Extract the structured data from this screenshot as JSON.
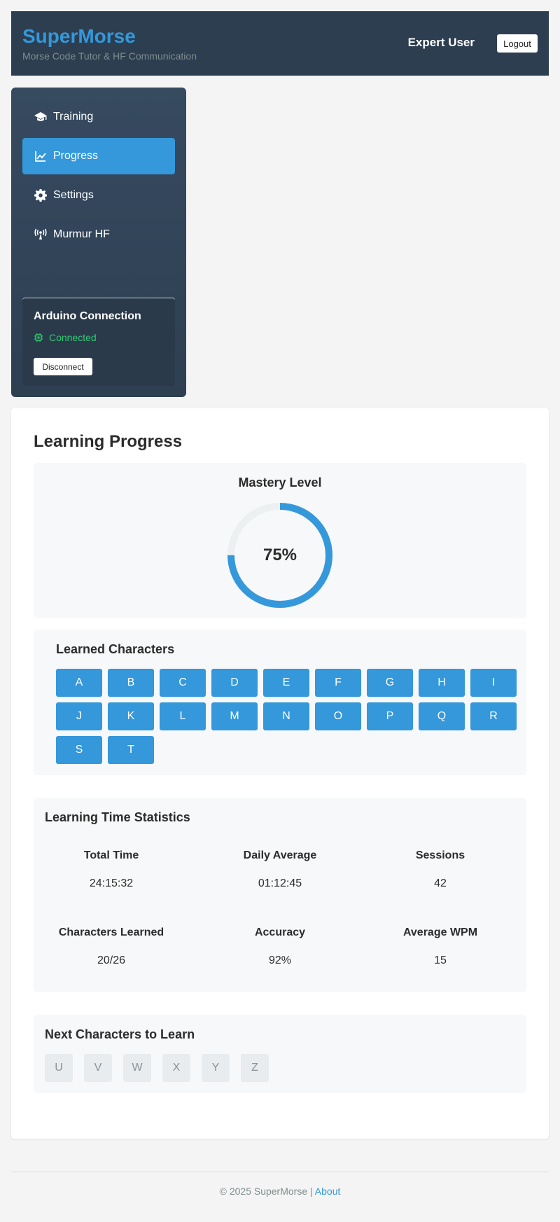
{
  "header": {
    "brand": "SuperMorse",
    "tagline": "Morse Code Tutor & HF Communication",
    "user_name": "Expert User",
    "logout_label": "Logout"
  },
  "sidebar": {
    "items": [
      {
        "label": "Training",
        "icon": "graduation-cap-icon"
      },
      {
        "label": "Progress",
        "icon": "line-chart-icon",
        "active": true
      },
      {
        "label": "Settings",
        "icon": "gear-icon"
      },
      {
        "label": "Murmur HF",
        "icon": "antenna-icon"
      }
    ],
    "arduino": {
      "title": "Arduino Connection",
      "status": "Connected",
      "status_color": "#2ecc71",
      "disconnect_label": "Disconnect"
    }
  },
  "main": {
    "title": "Learning Progress",
    "mastery": {
      "title": "Mastery Level",
      "value_text": "75%",
      "percent": 75
    },
    "learned": {
      "title": "Learned Characters",
      "chars": [
        "A",
        "B",
        "C",
        "D",
        "E",
        "F",
        "G",
        "H",
        "I",
        "J",
        "K",
        "L",
        "M",
        "N",
        "O",
        "P",
        "Q",
        "R",
        "S",
        "T"
      ]
    },
    "stats": {
      "title": "Learning Time Statistics",
      "items": [
        {
          "label": "Total Time",
          "value": "24:15:32"
        },
        {
          "label": "Daily Average",
          "value": "01:12:45"
        },
        {
          "label": "Sessions",
          "value": "42"
        },
        {
          "label": "Characters Learned",
          "value": "20/26"
        },
        {
          "label": "Accuracy",
          "value": "92%"
        },
        {
          "label": "Average WPM",
          "value": "15"
        }
      ]
    },
    "next": {
      "title": "Next Characters to Learn",
      "chars": [
        "U",
        "V",
        "W",
        "X",
        "Y",
        "Z"
      ]
    }
  },
  "footer": {
    "copyright": "© 2025 SuperMorse |",
    "about_label": "About"
  },
  "colors": {
    "accent": "#3498db",
    "header_bg": "#2d3e50",
    "connected": "#2ecc71"
  }
}
